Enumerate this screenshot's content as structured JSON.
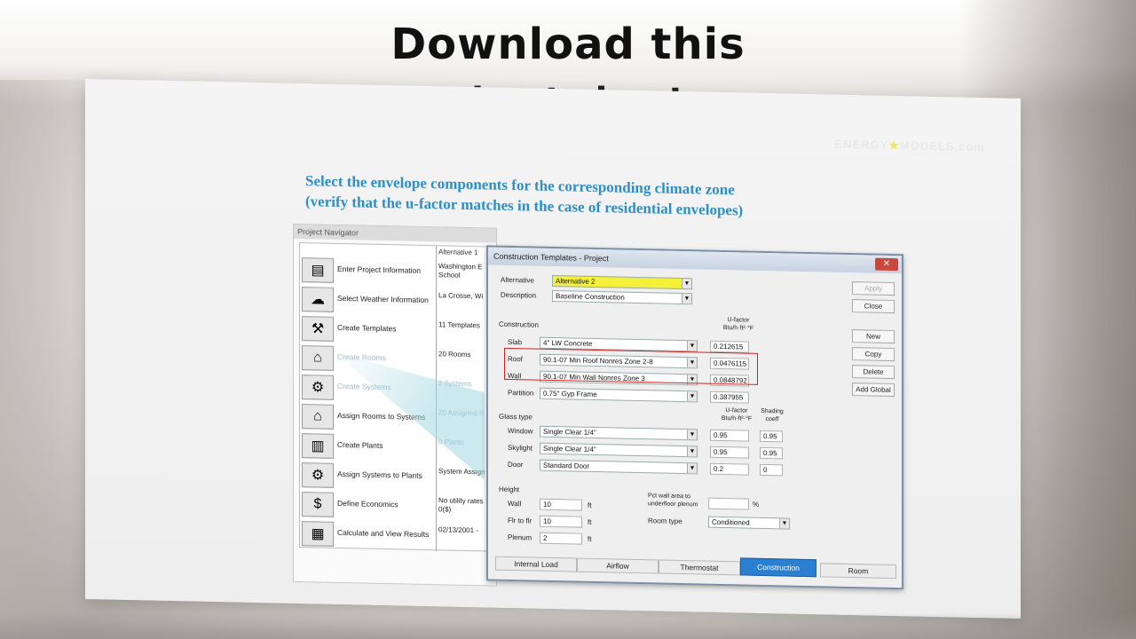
{
  "headline": "Download this",
  "headline_cutoff": "cheat sheet",
  "logo": {
    "left": "ENERGY",
    "star": "★",
    "right": "MODELS.com"
  },
  "slide_title": {
    "line1": "Select the envelope components for the corresponding climate zone",
    "line2": "(verify that the u-factor matches in the case of residential envelopes)"
  },
  "project_navigator": {
    "title": "Project Navigator",
    "column_header": "Alternative 1",
    "rows": [
      {
        "icon": "enter-project-icon",
        "glyph": "▤",
        "label": "Enter Project Information",
        "value": "Washington E School"
      },
      {
        "icon": "weather-icon",
        "glyph": "☁",
        "label": "Select Weather Information",
        "value": "La Crosse, Wi"
      },
      {
        "icon": "templates-icon",
        "glyph": "⚒",
        "label": "Create Templates",
        "value": "11 Templates"
      },
      {
        "icon": "rooms-icon",
        "glyph": "⌂",
        "label": "Create Rooms",
        "value": "20 Rooms"
      },
      {
        "icon": "systems-icon",
        "glyph": "⚙",
        "label": "Create Systems",
        "value": "2 Systems"
      },
      {
        "icon": "assign-rooms-icon",
        "glyph": "⌂",
        "label": "Assign Rooms to Systems",
        "value": "20 Assigned R"
      },
      {
        "icon": "plants-icon",
        "glyph": "▥",
        "label": "Create Plants",
        "value": "0 Plants"
      },
      {
        "icon": "assign-systems-icon",
        "glyph": "⚙",
        "label": "Assign Systems to Plants",
        "value": "System Assign"
      },
      {
        "icon": "economics-icon",
        "glyph": "$",
        "label": "Define Economics",
        "value": "No utility rates 0($)"
      },
      {
        "icon": "calculator-icon",
        "glyph": "▦",
        "label": "Calculate and View Results",
        "value": "02/13/2001 -"
      }
    ]
  },
  "dialog": {
    "title": "Construction Templates - Project",
    "close_glyph": "✕",
    "alternative_label": "Alternative",
    "alternative_value": "Alternative 2",
    "description_label": "Description",
    "description_value": "Baseline Construction",
    "construction_label": "Construction",
    "ufactor_header": "U-factor Btu/h·ft²·°F",
    "constructions": [
      {
        "label": "Slab",
        "value": "4\" LW Concrete",
        "ufactor": "0.212615"
      },
      {
        "label": "Roof",
        "value": "90.1-07 Min Roof Nonres Zone 2-8",
        "ufactor": "0.0476115"
      },
      {
        "label": "Wall",
        "value": "90.1-07 Min Wall Nonres Zone 3",
        "ufactor": "0.0848792"
      },
      {
        "label": "Partition",
        "value": "0.75\" Gyp Frame",
        "ufactor": "0.387955"
      }
    ],
    "glass_label": "Glass type",
    "glass_ufactor_header": "U-factor Btu/h·ft²·°F",
    "shading_header": "Shading coeff",
    "glass": [
      {
        "label": "Window",
        "value": "Single Clear 1/4\"",
        "ufactor": "0.95",
        "shading": "0.95"
      },
      {
        "label": "Skylight",
        "value": "Single Clear 1/4\"",
        "ufactor": "0.95",
        "shading": "0.95"
      },
      {
        "label": "Door",
        "value": "Standard Door",
        "ufactor": "0.2",
        "shading": "0"
      }
    ],
    "height_label": "Height",
    "heights": [
      {
        "label": "Wall",
        "value": "10",
        "unit": "ft"
      },
      {
        "label": "Flr to flr",
        "value": "10",
        "unit": "ft"
      },
      {
        "label": "Plenum",
        "value": "2",
        "unit": "ft"
      }
    ],
    "pct_wall_label": "Pct wall area to underfloor plenum",
    "pct_wall_value": "",
    "pct_unit": "%",
    "room_type_label": "Room type",
    "room_type_value": "Conditioned",
    "buttons": [
      "Apply",
      "Close",
      "New",
      "Copy",
      "Delete",
      "Add Global"
    ],
    "tabs": [
      "Internal Load",
      "Airflow",
      "Thermostat",
      "Construction",
      "Room"
    ],
    "active_tab": "Construction",
    "highlight_color": "#f5f03a"
  }
}
